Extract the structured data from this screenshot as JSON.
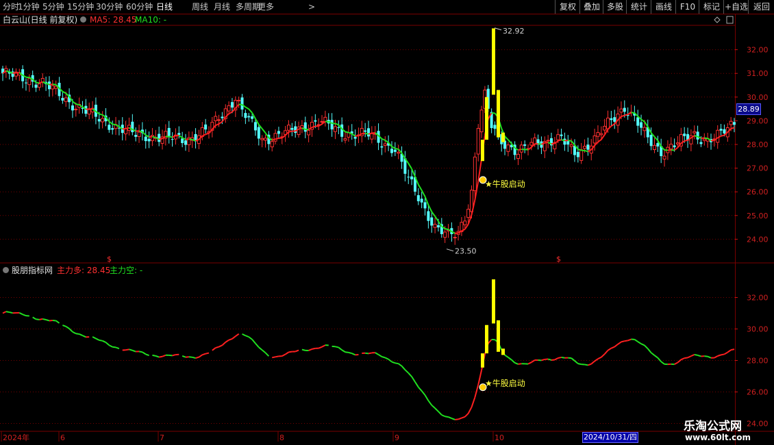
{
  "toolbar": {
    "periods": [
      "分时",
      "1分钟",
      "5分钟",
      "15分钟",
      "30分钟",
      "60分钟",
      "日线",
      "周线",
      "月线",
      "多周期",
      "更多"
    ],
    "active_period": "日线",
    "buttons": [
      "复权",
      "叠加",
      "多股",
      "统计",
      "画线",
      "F10",
      "标记",
      "+自选",
      "返回"
    ]
  },
  "main_panel": {
    "stock_title": "白云山(日线 前复权)",
    "ma5_label": "MA5: 28.45",
    "ma10_label": "MA10: -",
    "high_label": "32.92",
    "low_label": "23.50",
    "signal_label": "★牛股启动",
    "current_price": "28.89",
    "dollar_marker": "$"
  },
  "sub_panel": {
    "indicator_name": "股朋指标网",
    "bull_label": "主力多: 28.45",
    "bear_label": "主力空: -",
    "signal_label": "★牛股启动"
  },
  "x_axis": {
    "labels": [
      "2024年",
      "6",
      "7",
      "8",
      "9",
      "10"
    ],
    "cursor_date": "2024/10/31/四"
  },
  "watermark": {
    "title": "乐淘公式网",
    "url": "www.60lt.com"
  },
  "colors": {
    "up": "#ff3030",
    "down": "#54ffff",
    "ma_up": "#ff2020",
    "ma_down": "#20e020",
    "signal_bar": "#ffff00",
    "grid": "#7a0000"
  },
  "chart_data": [
    {
      "type": "candlestick",
      "title": "白云山(日线 前复权)",
      "ylim": [
        23.0,
        33.0
      ],
      "y_ticks": [
        24.0,
        25.0,
        26.0,
        27.0,
        28.0,
        29.0,
        30.0,
        31.0,
        32.0
      ],
      "close_anchors": [
        [
          0,
          31.0
        ],
        [
          12,
          30.6
        ],
        [
          20,
          29.8
        ],
        [
          30,
          29.0
        ],
        [
          40,
          28.4
        ],
        [
          48,
          28.3
        ],
        [
          55,
          28.2
        ],
        [
          62,
          28.6
        ],
        [
          70,
          30.0
        ],
        [
          72,
          29.4
        ],
        [
          78,
          28.2
        ],
        [
          88,
          28.6
        ],
        [
          95,
          29.0
        ],
        [
          102,
          28.5
        ],
        [
          110,
          28.4
        ],
        [
          118,
          27.8
        ],
        [
          122,
          26.5
        ],
        [
          125,
          25.8
        ],
        [
          130,
          24.5
        ],
        [
          134,
          24.1
        ],
        [
          137,
          24.3
        ],
        [
          139,
          25.0
        ],
        [
          141,
          26.0
        ],
        [
          143,
          28.8
        ],
        [
          145,
          30.0
        ],
        [
          147,
          28.8
        ],
        [
          150,
          28.2
        ],
        [
          155,
          27.6
        ],
        [
          160,
          28.1
        ],
        [
          168,
          28.2
        ],
        [
          172,
          27.6
        ],
        [
          178,
          28.2
        ],
        [
          183,
          29.0
        ],
        [
          187,
          29.6
        ],
        [
          190,
          29.1
        ],
        [
          194,
          28.2
        ],
        [
          198,
          27.7
        ],
        [
          202,
          28.0
        ],
        [
          208,
          28.4
        ],
        [
          212,
          28.2
        ],
        [
          216,
          28.4
        ],
        [
          220,
          28.9
        ]
      ],
      "n_bars": 221,
      "high": 32.92,
      "low": 23.5,
      "series": [
        {
          "name": "MA5",
          "value": 28.45
        },
        {
          "name": "MA10",
          "value": null
        }
      ]
    },
    {
      "type": "line",
      "title": "股朋指标网",
      "ylim": [
        23.5,
        33.5
      ],
      "y_ticks": [
        24.0,
        26.0,
        28.0,
        30.0,
        32.0
      ],
      "series": [
        {
          "name": "主力多",
          "value": 28.45
        },
        {
          "name": "主力空",
          "value": null
        }
      ]
    }
  ]
}
